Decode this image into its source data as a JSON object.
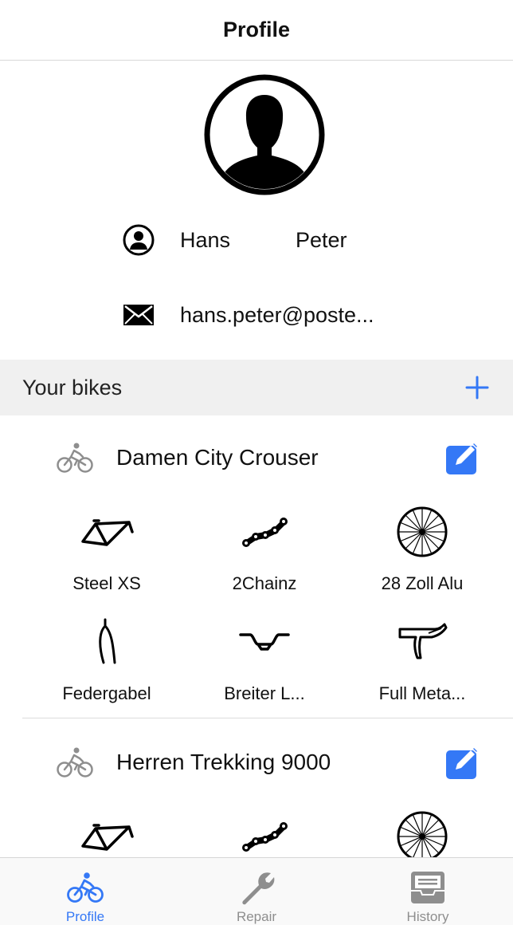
{
  "header": {
    "title": "Profile"
  },
  "profile": {
    "first_name": "Hans",
    "last_name": "Peter",
    "email": "hans.peter@poste..."
  },
  "bikes_section": {
    "title": "Your bikes"
  },
  "bikes": [
    {
      "name": "Damen City Crouser",
      "parts": [
        {
          "icon": "frame-icon",
          "label": "Steel XS"
        },
        {
          "icon": "chain-icon",
          "label": "2Chainz"
        },
        {
          "icon": "wheel-icon",
          "label": "28 Zoll Alu"
        },
        {
          "icon": "fork-icon",
          "label": "Federgabel"
        },
        {
          "icon": "handlebar-icon",
          "label": "Breiter L..."
        },
        {
          "icon": "brake-lever-icon",
          "label": "Full Meta..."
        }
      ]
    },
    {
      "name": "Herren Trekking 9000",
      "parts": [
        {
          "icon": "frame-icon",
          "label": ""
        },
        {
          "icon": "chain-icon",
          "label": ""
        },
        {
          "icon": "wheel-icon",
          "label": ""
        }
      ]
    }
  ],
  "tabbar": {
    "tabs": [
      {
        "label": "Profile",
        "icon": "bicycle-icon",
        "active": true
      },
      {
        "label": "Repair",
        "icon": "wrench-icon",
        "active": false
      },
      {
        "label": "History",
        "icon": "inbox-icon",
        "active": false
      }
    ]
  },
  "colors": {
    "accent": "#3478f6",
    "inactive": "#8e8e8e",
    "section_bg": "#f0f0f0"
  }
}
